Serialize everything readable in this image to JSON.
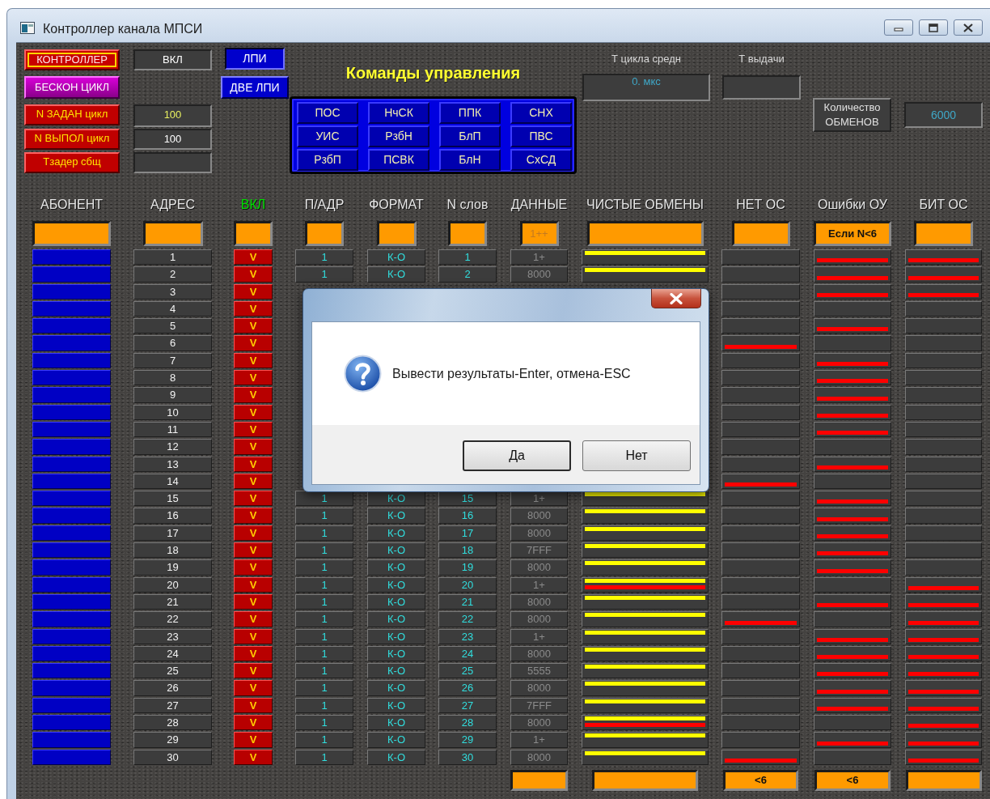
{
  "window": {
    "title": "Контроллер канала МПСИ"
  },
  "left_rows": [
    {
      "button": "КОНТРОЛЛЕР",
      "kind": "framed",
      "field": {
        "kind": "state",
        "value": "ВКЛ"
      }
    },
    {
      "button": "БЕСКОН ЦИКЛ",
      "kind": "loop"
    },
    {
      "button": "N ЗАДАН цикл",
      "kind": "param",
      "field": {
        "kind": "entry",
        "value": "100"
      }
    },
    {
      "button": "N ВЫПОЛ цикл",
      "kind": "param",
      "field": {
        "kind": "readout",
        "value": "100"
      }
    },
    {
      "button": "Тзадер сбщ",
      "kind": "param",
      "field": {
        "kind": "blank"
      }
    }
  ],
  "lpi_buttons": [
    {
      "label": "ЛПИ",
      "selected": true
    },
    {
      "label": "ДВЕ ЛПИ",
      "selected": false
    }
  ],
  "commands": {
    "title": "Команды управления",
    "buttons": [
      "ПОС",
      "НчСК",
      "ППК",
      "СНХ",
      "УИС",
      "РзбН",
      "БлП",
      "ПВС",
      "РзбП",
      "ПСВК",
      "БлН",
      "СхСД"
    ]
  },
  "timing": [
    {
      "label": "Т цикла средн",
      "value": "0. мкс"
    },
    {
      "label": "Т выдачи"
    }
  ],
  "exchanges": {
    "button": "Количество ОБМЕНОВ",
    "value": "6000"
  },
  "table": {
    "columns": [
      {
        "label": "АБОНЕНТ",
        "kind": "subscriber",
        "color": "#e6e6e6"
      },
      {
        "label": "АДРЕС",
        "kind": "address",
        "color": "#e6e6e6"
      },
      {
        "label": "ВКЛ",
        "kind": "enabled",
        "color": "#00e000"
      },
      {
        "label": "П/АДР",
        "kind": "sub_address",
        "color": "#e6e6e6"
      },
      {
        "label": "ФОРМАТ",
        "kind": "format",
        "color": "#e6e6e6"
      },
      {
        "label": "N слов",
        "kind": "words",
        "color": "#e6e6e6"
      },
      {
        "label": "ДАННЫЕ",
        "kind": "data",
        "color": "#e6e6e6",
        "filter": "1++",
        "footer": {
          "kind": "blank"
        }
      },
      {
        "label": "ЧИСТЫЕ ОБМЕНЫ",
        "kind": "clean",
        "color": "#e6e6e6",
        "footer": {
          "kind": "blank"
        }
      },
      {
        "label": "НЕТ ОС",
        "kind": "no_response",
        "color": "#e6e6e6",
        "footer": {
          "kind": "text",
          "value": "<6"
        }
      },
      {
        "label": "Ошибки ОУ",
        "kind": "rt_error",
        "color": "#e6e6e6",
        "filter": "Если N<6",
        "footer": {
          "kind": "text",
          "value": "<6"
        }
      },
      {
        "label": "БИТ ОС",
        "kind": "bit_error",
        "color": "#e6e6e6",
        "footer": {
          "kind": "blank"
        }
      }
    ],
    "rows": [
      {
        "address": "1",
        "enabled": "V",
        "sub_address": "1",
        "format": "К-О",
        "words": "1",
        "data": "1+",
        "clean": true,
        "clean_error": false,
        "no_response": false,
        "rt_error": true,
        "bit_error": true
      },
      {
        "address": "2",
        "enabled": "V",
        "sub_address": "1",
        "format": "К-О",
        "words": "2",
        "data": "8000",
        "clean": true,
        "clean_error": false,
        "no_response": false,
        "rt_error": true,
        "bit_error": true
      },
      {
        "address": "3",
        "enabled": "V",
        "no_response": false,
        "rt_error": true,
        "bit_error": true
      },
      {
        "address": "4",
        "enabled": "V",
        "no_response": false,
        "rt_error": false,
        "bit_error": false
      },
      {
        "address": "5",
        "enabled": "V",
        "no_response": false,
        "rt_error": true,
        "bit_error": false
      },
      {
        "address": "6",
        "enabled": "V",
        "no_response": true,
        "rt_error": false,
        "bit_error": false
      },
      {
        "address": "7",
        "enabled": "V",
        "no_response": false,
        "rt_error": true,
        "bit_error": false
      },
      {
        "address": "8",
        "enabled": "V",
        "no_response": false,
        "rt_error": true,
        "bit_error": false
      },
      {
        "address": "9",
        "enabled": "V",
        "no_response": false,
        "rt_error": true,
        "bit_error": false
      },
      {
        "address": "10",
        "enabled": "V",
        "no_response": false,
        "rt_error": true,
        "bit_error": false
      },
      {
        "address": "11",
        "enabled": "V",
        "no_response": false,
        "rt_error": true,
        "bit_error": false
      },
      {
        "address": "12",
        "enabled": "V",
        "no_response": false,
        "rt_error": false,
        "bit_error": false
      },
      {
        "address": "13",
        "enabled": "V",
        "no_response": false,
        "rt_error": true,
        "bit_error": false
      },
      {
        "address": "14",
        "enabled": "V",
        "no_response": true,
        "rt_error": false,
        "bit_error": false
      },
      {
        "address": "15",
        "enabled": "V",
        "sub_address": "1",
        "format": "К-О",
        "words": "15",
        "data": "1+",
        "clean": true,
        "clean_error": false,
        "no_response": false,
        "rt_error": true,
        "bit_error": false
      },
      {
        "address": "16",
        "enabled": "V",
        "sub_address": "1",
        "format": "К-О",
        "words": "16",
        "data": "8000",
        "clean": true,
        "clean_error": false,
        "no_response": false,
        "rt_error": true,
        "bit_error": false
      },
      {
        "address": "17",
        "enabled": "V",
        "sub_address": "1",
        "format": "К-О",
        "words": "17",
        "data": "8000",
        "clean": true,
        "clean_error": false,
        "no_response": false,
        "rt_error": true,
        "bit_error": false
      },
      {
        "address": "18",
        "enabled": "V",
        "sub_address": "1",
        "format": "К-О",
        "words": "18",
        "data": "7FFF",
        "clean": true,
        "clean_error": false,
        "no_response": false,
        "rt_error": true,
        "bit_error": false
      },
      {
        "address": "19",
        "enabled": "V",
        "sub_address": "1",
        "format": "К-О",
        "words": "19",
        "data": "8000",
        "clean": true,
        "clean_error": false,
        "no_response": false,
        "rt_error": true,
        "bit_error": false
      },
      {
        "address": "20",
        "enabled": "V",
        "sub_address": "1",
        "format": "К-О",
        "words": "20",
        "data": "1+",
        "clean": true,
        "clean_error": true,
        "no_response": false,
        "rt_error": false,
        "bit_error": true
      },
      {
        "address": "21",
        "enabled": "V",
        "sub_address": "1",
        "format": "К-О",
        "words": "21",
        "data": "8000",
        "clean": true,
        "clean_error": false,
        "no_response": false,
        "rt_error": true,
        "bit_error": true
      },
      {
        "address": "22",
        "enabled": "V",
        "sub_address": "1",
        "format": "К-О",
        "words": "22",
        "data": "8000",
        "clean": true,
        "clean_error": false,
        "no_response": true,
        "rt_error": false,
        "bit_error": true
      },
      {
        "address": "23",
        "enabled": "V",
        "sub_address": "1",
        "format": "К-О",
        "words": "23",
        "data": "1+",
        "clean": true,
        "clean_error": false,
        "no_response": false,
        "rt_error": true,
        "bit_error": true
      },
      {
        "address": "24",
        "enabled": "V",
        "sub_address": "1",
        "format": "К-О",
        "words": "24",
        "data": "8000",
        "clean": true,
        "clean_error": false,
        "no_response": false,
        "rt_error": true,
        "bit_error": true
      },
      {
        "address": "25",
        "enabled": "V",
        "sub_address": "1",
        "format": "К-О",
        "words": "25",
        "data": "5555",
        "clean": true,
        "clean_error": false,
        "no_response": false,
        "rt_error": true,
        "bit_error": true
      },
      {
        "address": "26",
        "enabled": "V",
        "sub_address": "1",
        "format": "К-О",
        "words": "26",
        "data": "8000",
        "clean": true,
        "clean_error": false,
        "no_response": false,
        "rt_error": true,
        "bit_error": true
      },
      {
        "address": "27",
        "enabled": "V",
        "sub_address": "1",
        "format": "К-О",
        "words": "27",
        "data": "7FFF",
        "clean": true,
        "clean_error": false,
        "no_response": false,
        "rt_error": true,
        "bit_error": true
      },
      {
        "address": "28",
        "enabled": "V",
        "sub_address": "1",
        "format": "К-О",
        "words": "28",
        "data": "8000",
        "clean": true,
        "clean_error": true,
        "no_response": false,
        "rt_error": false,
        "bit_error": true
      },
      {
        "address": "29",
        "enabled": "V",
        "sub_address": "1",
        "format": "К-О",
        "words": "29",
        "data": "1+",
        "clean": true,
        "clean_error": false,
        "no_response": false,
        "rt_error": true,
        "bit_error": true
      },
      {
        "address": "30",
        "enabled": "V",
        "sub_address": "1",
        "format": "К-О",
        "words": "30",
        "data": "8000",
        "clean": true,
        "clean_error": false,
        "no_response": true,
        "rt_error": false,
        "bit_error": true
      }
    ]
  },
  "dialog": {
    "message": "Вывести результаты-Enter, отмена-ESC",
    "buttons": [
      {
        "label": "Да",
        "selected": true
      },
      {
        "label": "Нет",
        "selected": false
      }
    ]
  }
}
